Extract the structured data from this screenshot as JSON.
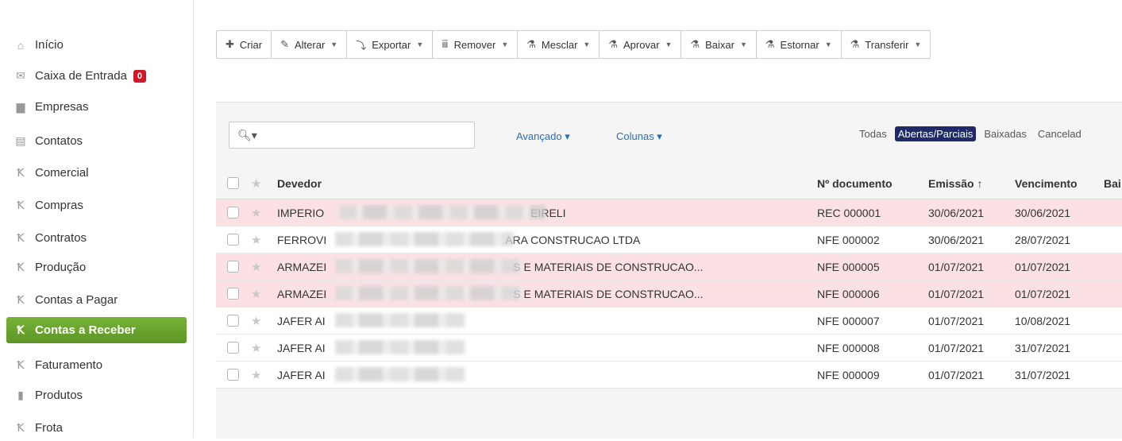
{
  "sidebar": {
    "items": [
      {
        "label": "Início",
        "icon": "home-icon",
        "glyph": "⌂"
      },
      {
        "label": "Caixa de Entrada",
        "icon": "envelope-icon",
        "glyph": "✉",
        "badge": "0"
      },
      {
        "label": "Empresas",
        "icon": "folder-icon",
        "glyph": "▆"
      },
      {
        "label": "Contatos",
        "icon": "contact-card-icon",
        "glyph": "▤"
      },
      {
        "label": "Comercial",
        "icon": "module-icon",
        "glyph": "Ꝁ"
      },
      {
        "label": "Compras",
        "icon": "module-icon",
        "glyph": "Ꝁ"
      },
      {
        "label": "Contratos",
        "icon": "module-icon",
        "glyph": "Ꝁ"
      },
      {
        "label": "Produção",
        "icon": "module-icon",
        "glyph": "Ꝁ"
      },
      {
        "label": "Contas a Pagar",
        "icon": "module-icon",
        "glyph": "Ꝁ"
      },
      {
        "label": "Contas a Receber",
        "icon": "module-icon",
        "glyph": "Ꝁ"
      },
      {
        "label": "Faturamento",
        "icon": "module-icon",
        "glyph": "Ꝁ"
      },
      {
        "label": "Produtos",
        "icon": "box-icon",
        "glyph": "▮"
      },
      {
        "label": "Frota",
        "icon": "module-icon",
        "glyph": "Ꝁ"
      }
    ]
  },
  "toolbar": {
    "buttons": [
      {
        "label": "Criar",
        "glyph": "✚"
      },
      {
        "label": "Alterar",
        "glyph": "✎"
      },
      {
        "label": "Exportar",
        "glyph": "⤵"
      },
      {
        "label": "Remover",
        "glyph": "🗑"
      },
      {
        "label": "Mesclar",
        "glyph": "⚗"
      },
      {
        "label": "Aprovar",
        "glyph": "⚗"
      },
      {
        "label": "Baixar",
        "glyph": "⚗"
      },
      {
        "label": "Estornar",
        "glyph": "⚗"
      },
      {
        "label": "Transferir",
        "glyph": "⚗"
      }
    ]
  },
  "search": {
    "placeholder": ""
  },
  "links": {
    "advanced": "Avançado ▾",
    "columns": "Colunas ▾"
  },
  "filters": [
    "Todas",
    "Abertas/Parciais",
    "Baixadas",
    "Cancelad"
  ],
  "table": {
    "headers": {
      "devedor": "Devedor",
      "documento": "Nº documento",
      "emissao": "Emissão ↑",
      "vencimento": "Vencimento",
      "baixa": "Bai"
    },
    "rows": [
      {
        "devedor_start": "IMPERIO",
        "devedor_end": "EIRELI",
        "documento": "REC 000001",
        "emissao": "30/06/2021",
        "vencimento": "30/06/2021"
      },
      {
        "devedor_start": "FERROVI",
        "devedor_end": "ARA CONSTRUCAO LTDA",
        "documento": "NFE 000002",
        "emissao": "30/06/2021",
        "vencimento": "28/07/2021"
      },
      {
        "devedor_start": "ARMAZEI",
        "devedor_end": "S E MATERIAIS DE CONSTRUCAO...",
        "documento": "NFE 000005",
        "emissao": "01/07/2021",
        "vencimento": "01/07/2021"
      },
      {
        "devedor_start": "ARMAZEI",
        "devedor_end": "S E MATERIAIS DE CONSTRUCAO...",
        "documento": "NFE 000006",
        "emissao": "01/07/2021",
        "vencimento": "01/07/2021"
      },
      {
        "devedor_start": "JAFER AI",
        "devedor_end": "",
        "documento": "NFE 000007",
        "emissao": "01/07/2021",
        "vencimento": "10/08/2021"
      },
      {
        "devedor_start": "JAFER AI",
        "devedor_end": "",
        "documento": "NFE 000008",
        "emissao": "01/07/2021",
        "vencimento": "31/07/2021"
      },
      {
        "devedor_start": "JAFER AI",
        "devedor_end": "",
        "documento": "NFE 000009",
        "emissao": "01/07/2021",
        "vencimento": "31/07/2021"
      }
    ]
  },
  "colors": {
    "active_green": "#6aa62d",
    "badge_red": "#d0182a",
    "filter_active": "#1f2a6a",
    "row_pink": "#fbe1e3",
    "link_blue": "#2a6ebb"
  }
}
